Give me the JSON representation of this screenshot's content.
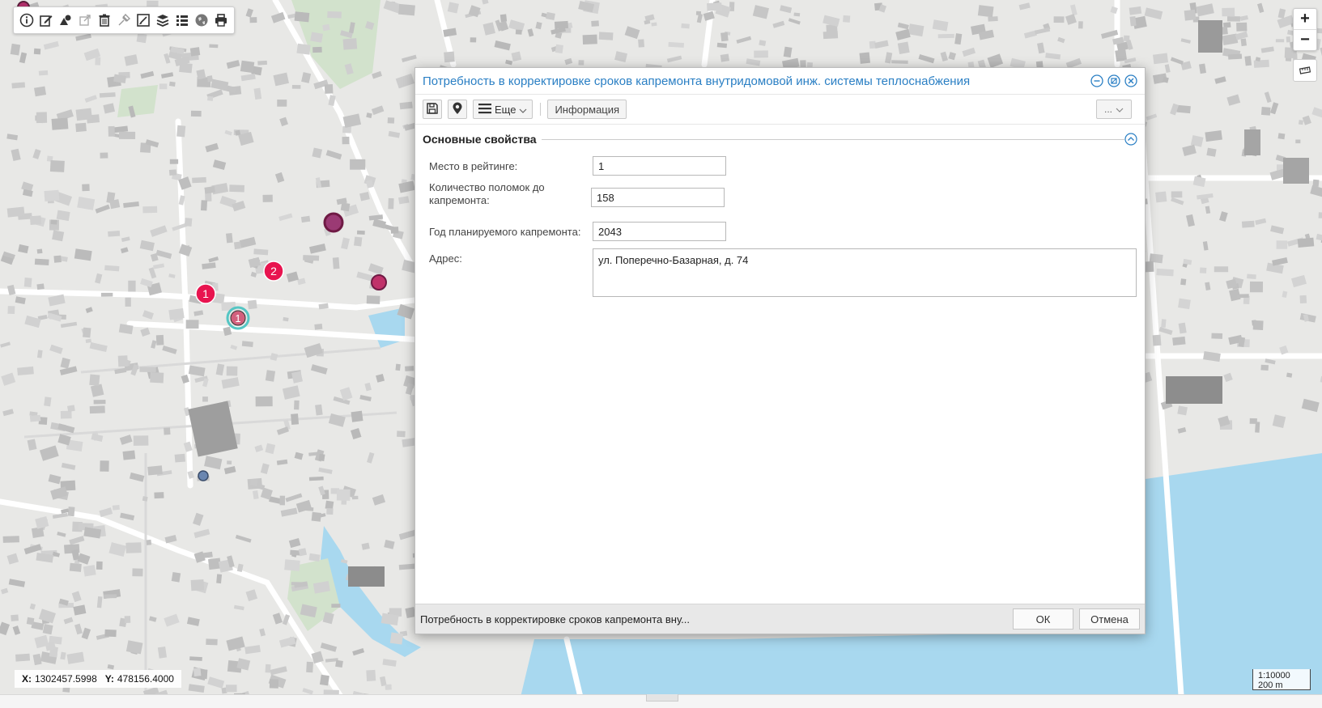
{
  "map": {
    "toolbar_icons": [
      "info-icon",
      "edit-icon",
      "shapes-icon",
      "external-link-icon",
      "trash-icon",
      "pin-icon",
      "edit-box-icon",
      "layers-icon",
      "list-icon",
      "globe-icon",
      "print-icon"
    ],
    "zoom_in": "+",
    "zoom_out": "−",
    "markers": [
      {
        "label": "1"
      },
      {
        "label": "2"
      },
      {
        "label": "1"
      }
    ],
    "coords": {
      "x_label": "X:",
      "x_value": "1302457.5998",
      "y_label": "Y:",
      "y_value": "478156.4000"
    },
    "scale": {
      "ratio": "1:10000",
      "distance": "200 m"
    },
    "colors": {
      "water": "#a8d8ef",
      "marker_red": "#e8144f",
      "marker_purple": "#b0306a",
      "marker_teal": "#55c6c4",
      "marker_blue": "#6a86b0"
    }
  },
  "dialog": {
    "title": "Потребность в корректировке сроков капремонта внутридомовой инж. системы теплоснабжения",
    "toolbar": {
      "more_label": "Еще",
      "info_label": "Информация",
      "overflow_label": "..."
    },
    "section_title": "Основные свойства",
    "fields": {
      "rank_label": "Место в рейтинге:",
      "rank_value": "1",
      "breakdowns_label": "Количество поломок до капремонта:",
      "breakdowns_value": "158",
      "year_label": "Год планируемого капремонта:",
      "year_value": "2043",
      "address_label": "Адрес:",
      "address_value": "ул. Поперечно-Базарная, д. 74"
    },
    "footer": {
      "summary": "Потребность в корректировке сроков капремонта вну...",
      "ok_label": "ОК",
      "cancel_label": "Отмена"
    }
  }
}
